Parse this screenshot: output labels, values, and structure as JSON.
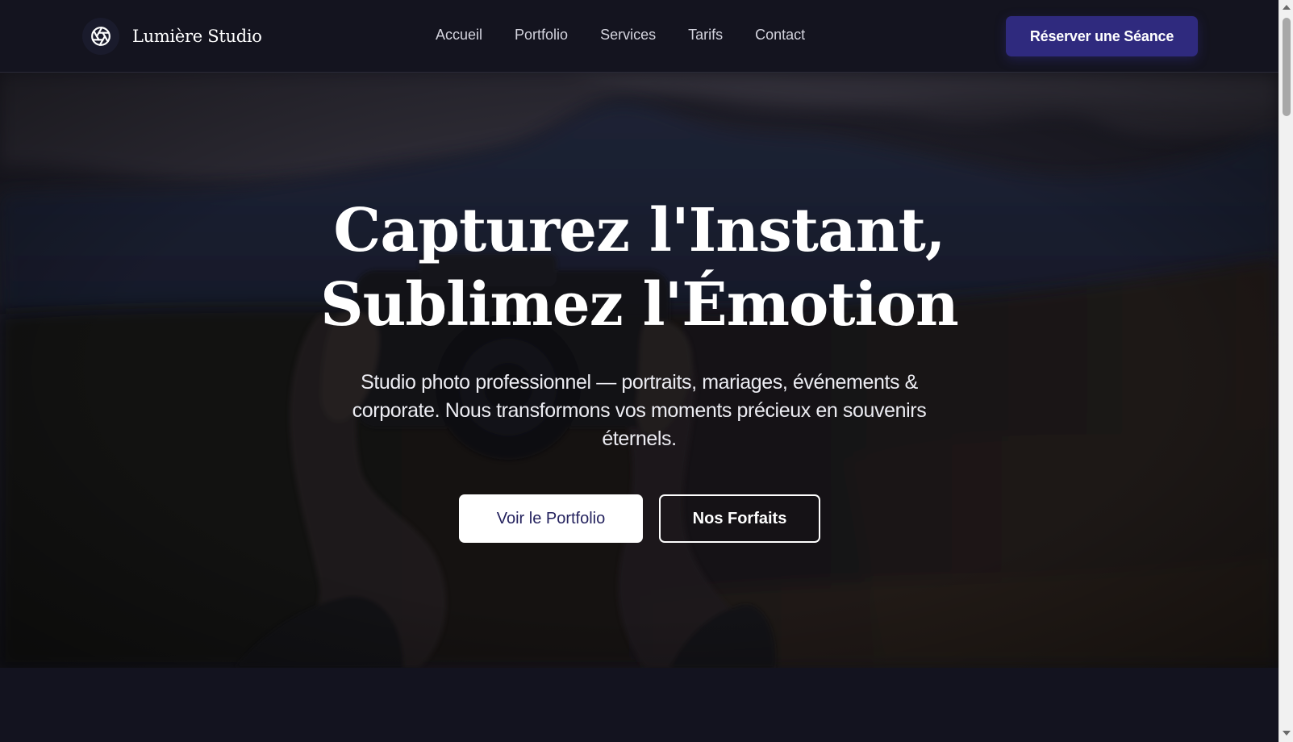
{
  "brand": {
    "name": "Lumière Studio",
    "logo_icon": "aperture-icon"
  },
  "nav": {
    "links": [
      "Accueil",
      "Portfolio",
      "Services",
      "Tarifs",
      "Contact"
    ],
    "cta_label": "Réserver une Séance"
  },
  "hero": {
    "title_line1": "Capturez l'Instant,",
    "title_line2": "Sublimez l'Émotion",
    "subtitle": "Studio photo professionnel — portraits, mariages, événements & corporate. Nous transformons vos moments précieux en souvenirs éternels.",
    "primary_button": "Voir le Portfolio",
    "secondary_button": "Nos Forfaits",
    "background_image": "hands-holding-camera-mountain-photo"
  },
  "colors": {
    "nav_background": "#14141f",
    "accent": "#2f2a7e",
    "page_background": "#13131f",
    "text_primary": "#ffffff",
    "primary_button_text": "#24225e"
  }
}
